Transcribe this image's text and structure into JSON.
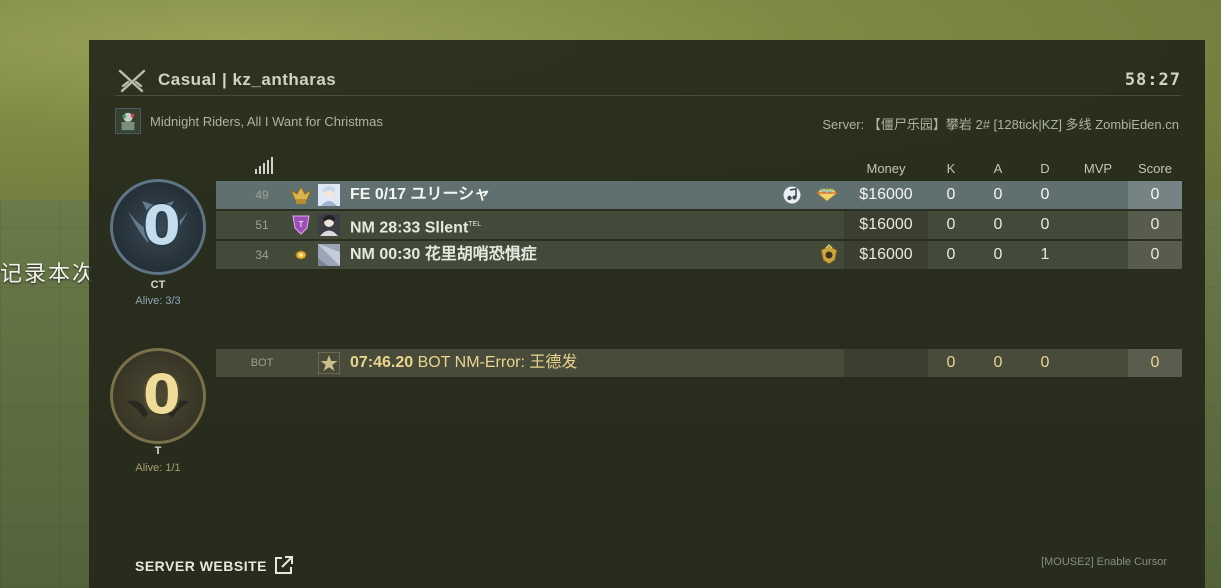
{
  "background": {
    "overlay_text": "记录本次"
  },
  "header": {
    "mode_icon": "crossed-swords-icon",
    "title": "Casual | kz_antharas",
    "timer": "58:27"
  },
  "subheader": {
    "music_avatar_icon": "music-kit-avatar-icon",
    "music_label": "Midnight Riders, All I Want for Christmas",
    "server_label": "Server: 【僵尸乐园】攀岩 2# [128tick|KZ] 多线 ZombiEden.cn"
  },
  "columns": {
    "signal_icon": "signal-bars-icon",
    "money": "Money",
    "k": "K",
    "a": "A",
    "d": "D",
    "mvp": "MVP",
    "score": "Score"
  },
  "teams": {
    "ct": {
      "score": "0",
      "name": "CT",
      "alive": "Alive: 3/3",
      "color": "#a8c4dd"
    },
    "t": {
      "score": "0",
      "name": "T",
      "alive": "Alive: 1/1",
      "color": "#e3cf8e"
    }
  },
  "ct_players": [
    {
      "rank": "49",
      "badge_icon": "gold-eagle-rank-icon",
      "clan": "FE",
      "name": "0/17 ユリーシャ",
      "status_icon": "music-note-icon",
      "extra_icon": "gem-badge-icon",
      "money": "$16000",
      "k": "0",
      "a": "0",
      "d": "0",
      "mvp": "",
      "score": "0"
    },
    {
      "rank": "51",
      "badge_icon": "purple-rank-icon",
      "clan": "NM",
      "name": "28:33 Sllent",
      "name_sup": "TEL",
      "money": "$16000",
      "k": "0",
      "a": "0",
      "d": "0",
      "mvp": "",
      "score": "0"
    },
    {
      "rank": "34",
      "badge_icon": "gold-coin-rank-icon",
      "clan": "NM",
      "name": "00:30 花里胡哨恐惧症",
      "extra_icon": "gold-crest-icon",
      "money": "$16000",
      "k": "0",
      "a": "0",
      "d": "1",
      "mvp": "",
      "score": "0"
    }
  ],
  "t_players": [
    {
      "rank": "BOT",
      "avatar_icon": "bot-star-icon",
      "clan": "07:46.20",
      "name": "BOT NM-Error: 王德发",
      "money": "",
      "k": "0",
      "a": "0",
      "d": "0",
      "mvp": "",
      "score": "0"
    }
  ],
  "footer": {
    "website_label": "SERVER WEBSITE",
    "website_icon": "external-link-icon",
    "hint": "[MOUSE2] Enable Cursor"
  }
}
